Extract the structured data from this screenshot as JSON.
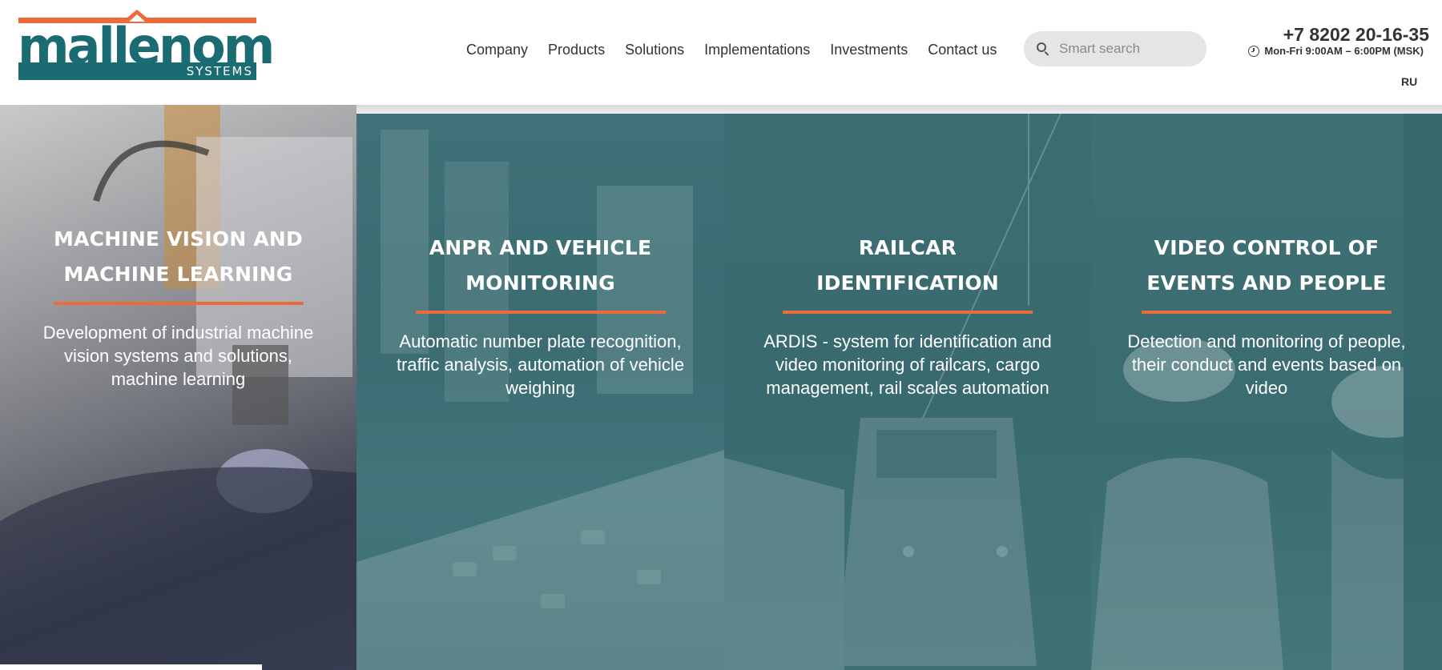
{
  "logo": {
    "wordmark": "mallenom",
    "subtitle": "SYSTEMS",
    "colors": {
      "teal": "#1b6b72",
      "orange": "#ec6b3a"
    }
  },
  "nav": {
    "items": [
      {
        "label": "Company"
      },
      {
        "label": "Products"
      },
      {
        "label": "Solutions"
      },
      {
        "label": "Implementations"
      },
      {
        "label": "Investments"
      },
      {
        "label": "Contact us"
      }
    ]
  },
  "search": {
    "icon": "search-icon",
    "placeholder": "Smart search",
    "value": ""
  },
  "contact": {
    "phone": "+7 8202 20-16-35",
    "hours": "Mon-Fri 9:00AM – 6:00PM (MSK)",
    "hours_icon": "clock-icon"
  },
  "language": {
    "label": "RU"
  },
  "panels": [
    {
      "title_line1": "MACHINE VISION AND",
      "title_line2": "MACHINE LEARNING",
      "description": "Development of industrial machine vision systems and solutions, machine learning"
    },
    {
      "title_line1": "ANPR AND VEHICLE",
      "title_line2": "MONITORING",
      "description": "Automatic number plate recognition, traffic analysis, automation of vehicle weighing"
    },
    {
      "title_line1": "RAILCAR",
      "title_line2": "IDENTIFICATION",
      "description": "ARDIS - system for identification and video monitoring of railcars, cargo management, rail scales automation"
    },
    {
      "title_line1": "VIDEO CONTROL OF",
      "title_line2": "EVENTS AND PEOPLE",
      "description": "Detection and monitoring of people, their conduct and events based on video"
    }
  ],
  "theme": {
    "accent": "#ec6b3a",
    "panel_teal": "#3b6d73"
  }
}
